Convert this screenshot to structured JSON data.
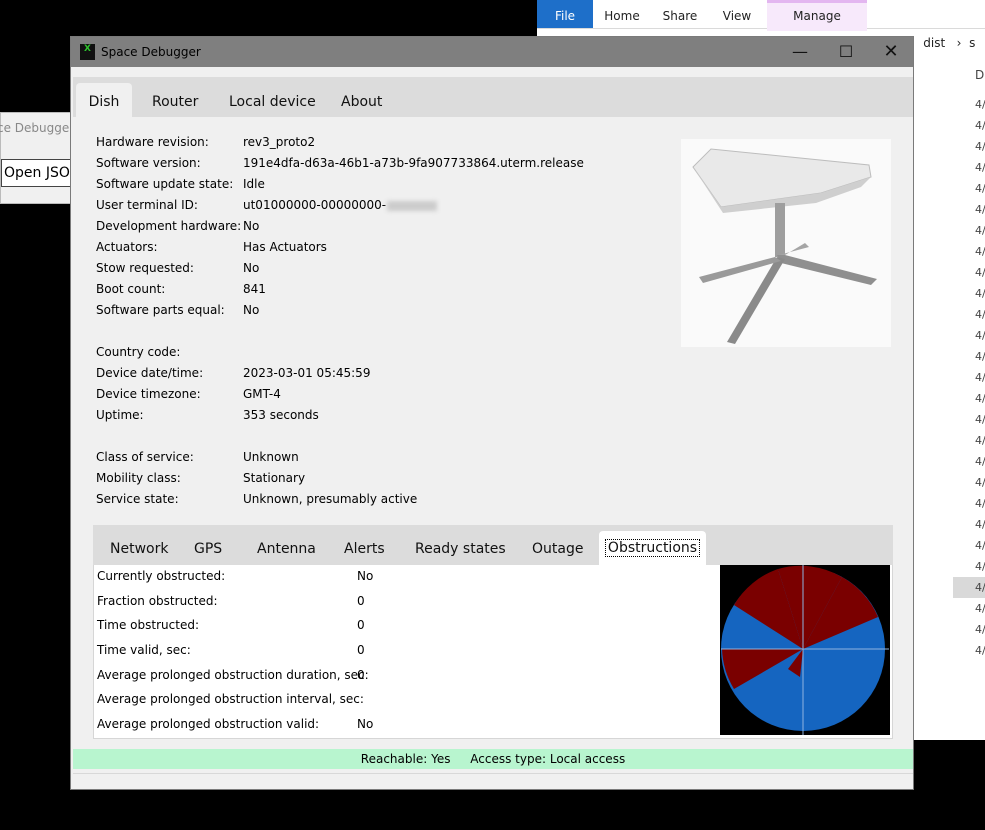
{
  "explorer": {
    "ribbon": {
      "file": "File",
      "home": "Home",
      "share": "Share",
      "view": "View",
      "manage": "Manage"
    },
    "breadcrumb": {
      "sep1": "›",
      "dist": "dist",
      "sep2": "›",
      "next": "s"
    },
    "date_header": "Da",
    "date_cell": "4/"
  },
  "background_fragment": {
    "title": "ce Debugger:",
    "button": "Open JSON"
  },
  "window": {
    "title": "Space Debugger",
    "icon_text": "X",
    "tabs": [
      "Dish",
      "Router",
      "Local device",
      "About"
    ],
    "controls": {
      "minimize": "—",
      "maximize": "☐",
      "close": "✕"
    }
  },
  "dish": {
    "fields": [
      {
        "label": "Hardware revision:",
        "value": "rev3_proto2"
      },
      {
        "label": "Software version:",
        "value": "191e4dfa-d63a-46b1-a73b-9fa907733864.uterm.release"
      },
      {
        "label": "Software update state:",
        "value": "Idle"
      },
      {
        "label": "User terminal ID:",
        "value": "ut01000000-00000000-"
      },
      {
        "label": "Development hardware:",
        "value": "No"
      },
      {
        "label": "Actuators:",
        "value": "Has Actuators"
      },
      {
        "label": "Stow requested:",
        "value": "No"
      },
      {
        "label": "Boot count:",
        "value": "841"
      },
      {
        "label": "Software parts equal:",
        "value": "No"
      },
      {
        "label": "Country code:",
        "value": ""
      },
      {
        "label": "Device date/time:",
        "value": "2023-03-01 05:45:59"
      },
      {
        "label": "Device timezone:",
        "value": "GMT-4"
      },
      {
        "label": "Uptime:",
        "value": "353 seconds"
      },
      {
        "label": "Class of service:",
        "value": "Unknown"
      },
      {
        "label": "Mobility class:",
        "value": "Stationary"
      },
      {
        "label": "Service state:",
        "value": "Unknown, presumably active"
      }
    ]
  },
  "subtabs": [
    "Network",
    "GPS",
    "Antenna",
    "Alerts",
    "Ready states",
    "Outage",
    "Obstructions"
  ],
  "obstructions": {
    "fields": [
      {
        "label": "Currently obstructed:",
        "value": "No"
      },
      {
        "label": "Fraction obstructed:",
        "value": "0"
      },
      {
        "label": "Time obstructed:",
        "value": "0"
      },
      {
        "label": "Time valid, sec:",
        "value": "0"
      },
      {
        "label": "Average prolonged obstruction duration, sec:",
        "value": "0"
      },
      {
        "label": "Average prolonged obstruction interval, sec:",
        "value": ""
      },
      {
        "label": "Average prolonged obstruction valid:",
        "value": "No"
      }
    ],
    "map_colors": {
      "clear": "#1565c0",
      "obstructed": "#7a0000",
      "background": "#000000"
    }
  },
  "status": {
    "reachable": "Reachable: Yes",
    "access": "Access type: Local access"
  }
}
